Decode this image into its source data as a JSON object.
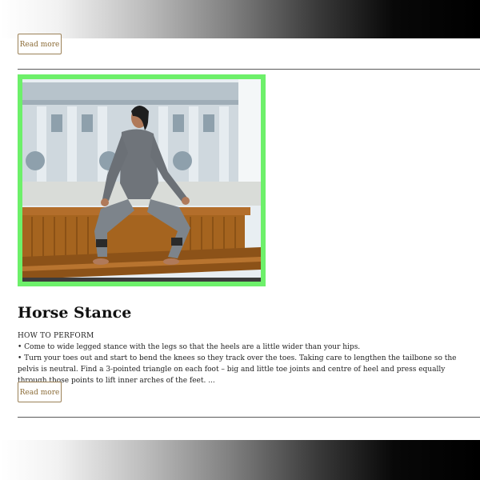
{
  "previous_post": {
    "read_more_label": "Read more"
  },
  "post": {
    "title": "Horse Stance",
    "subheading": "HOW TO PERFORM",
    "steps": [
      "• Come to wide legged stance with the legs so that the heels are a little wider than your hips.",
      "• Turn your toes out and start to bend the knees so they track over the toes. Taking care to lengthen the tailbone so the pelvis is neutral. Find a 3-pointed triangle on each foot – big and little toe joints and centre of heel and press equally through those points to lift inner arches of the feet. ..."
    ],
    "read_more_label": "Read more",
    "image_border_color": "#6df06a"
  }
}
